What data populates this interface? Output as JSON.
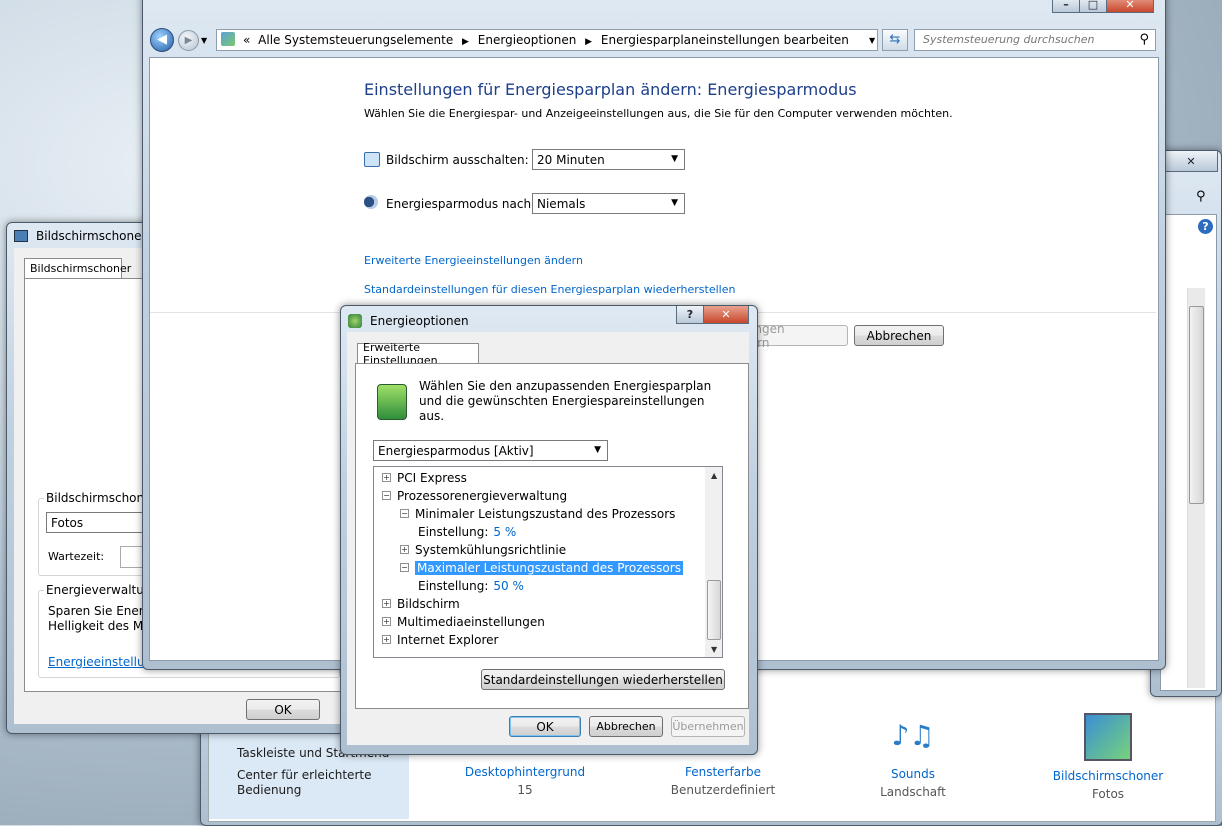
{
  "main_window": {
    "breadcrumb_prefix": "«",
    "breadcrumb": [
      "Alle Systemsteuerungselemente",
      "Energieoptionen",
      "Energiesparplaneinstellungen bearbeiten"
    ],
    "search_placeholder": "Systemsteuerung durchsuchen",
    "title": "Einstellungen für Energiesparplan ändern: Energiesparmodus",
    "subtitle": "Wählen Sie die Energiespar- und Anzeigeeinstellungen aus, die Sie für den Computer verwenden möchten.",
    "display_off_label": "Bildschirm ausschalten:",
    "display_off_value": "20 Minuten",
    "sleep_label": "Energiesparmodus nach:",
    "sleep_value": "Niemals",
    "link_advanced": "Erweiterte Energieeinstellungen ändern",
    "link_restore": "Standardeinstellungen für diesen Energiesparplan wiederherstellen",
    "save_button": "Änderungen speichern",
    "cancel_button": "Abbrechen"
  },
  "screensaver_dialog": {
    "title": "Bildschirmschonereinstellungen",
    "tab": "Bildschirmschoner",
    "group_screensaver": "Bildschirmschoner",
    "screensaver_value": "Fotos",
    "wait_label": "Wartezeit:",
    "group_power": "Energieverwaltung",
    "power_text": "Sparen Sie Energie oder optimieren Sie die Leistung, indem Sie die Helligkeit des Monitors und andere Energieeinstellungen anpassen.",
    "power_text_visible_1": "Sparen Sie Energi",
    "power_text_visible_2": "Helligkeit des Mo",
    "power_link": "Energieeinstellung",
    "ok_button": "OK"
  },
  "personalization": {
    "side_links": [
      "Taskleiste und Startmenü",
      "Center für erleichterte Bedienung"
    ],
    "items": [
      {
        "label": "Desktophintergrund",
        "sub": "15"
      },
      {
        "label": "Fensterfarbe",
        "sub": "Benutzerdefiniert"
      },
      {
        "label": "Sounds",
        "sub": "Landschaft"
      },
      {
        "label": "Bildschirmschoner",
        "sub": "Fotos"
      }
    ]
  },
  "power_options_dialog": {
    "title": "Energieoptionen",
    "help_glyph": "?",
    "close_glyph": "✕",
    "tab": "Erweiterte Einstellungen",
    "description": "Wählen Sie den anzupassenden Energiesparplan und die gewünschten Energiespareinstellungen aus.",
    "plan_value": "Energiesparmodus [Aktiv]",
    "tree": [
      {
        "label": "PCI Express",
        "sign": "+",
        "indent": 0
      },
      {
        "label": "Prozessorenergieverwaltung",
        "sign": "−",
        "indent": 0
      },
      {
        "label": "Minimaler Leistungszustand des Prozessors",
        "sign": "−",
        "indent": 1
      },
      {
        "label": "Einstellung:",
        "value": "5 %",
        "indent": 2
      },
      {
        "label": "Systemkühlungsrichtlinie",
        "sign": "+",
        "indent": 1
      },
      {
        "label": "Maximaler Leistungszustand des Prozessors",
        "sign": "−",
        "indent": 1,
        "selected": true
      },
      {
        "label": "Einstellung:",
        "value": "50 %",
        "indent": 2
      },
      {
        "label": "Bildschirm",
        "sign": "+",
        "indent": 0
      },
      {
        "label": "Multimediaeinstellungen",
        "sign": "+",
        "indent": 0
      },
      {
        "label": "Internet Explorer",
        "sign": "+",
        "indent": 0
      }
    ],
    "restore_button": "Standardeinstellungen wiederherstellen",
    "ok_button": "OK",
    "cancel_button": "Abbrechen",
    "apply_button": "Übernehmen"
  },
  "colors": {
    "title_blue": "#1e3f8a",
    "link_blue": "#0066cc",
    "selection": "#3399ff"
  }
}
